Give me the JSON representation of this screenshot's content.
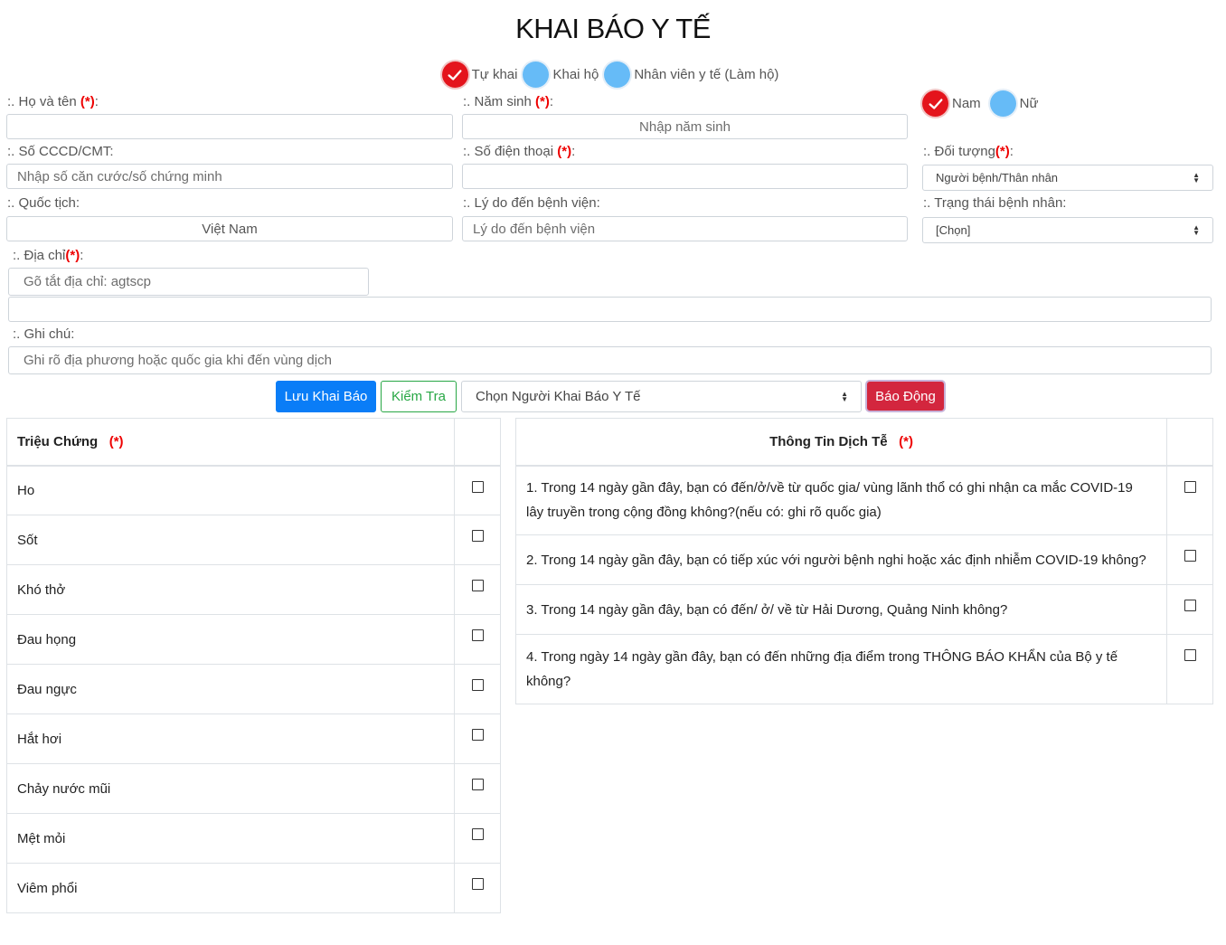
{
  "title": "KHAI BÁO Y TẾ",
  "declare_modes": [
    {
      "label": "Tự khai",
      "checked": true
    },
    {
      "label": "Khai hộ",
      "checked": false
    },
    {
      "label": "Nhân viên y tế (Làm hộ)",
      "checked": false
    }
  ],
  "form": {
    "req_marker": "(*)",
    "full_name": {
      "label": ":. Họ và tên ",
      "value": ""
    },
    "birth_year": {
      "label": ":. Năm sinh ",
      "placeholder": "Nhập năm sinh"
    },
    "gender": [
      {
        "label": "Nam",
        "checked": true
      },
      {
        "label": "Nữ",
        "checked": false
      }
    ],
    "id_number": {
      "label": ":. Số CCCD/CMT:",
      "placeholder": "Nhập số căn cước/số chứng minh"
    },
    "phone": {
      "label": ":. Số điện thoại ",
      "value": ""
    },
    "subject": {
      "label": ":. Đối tượng",
      "selected": "Người bệnh/Thân nhân"
    },
    "nationality": {
      "label": ":. Quốc tịch:",
      "value": "Việt Nam"
    },
    "visit_reason": {
      "label": ":. Lý do đến bệnh viện:",
      "placeholder": "Lý do đến bệnh viện"
    },
    "patient_status": {
      "label": ":. Trạng thái bệnh nhân:",
      "selected": "[Chọn]"
    },
    "address": {
      "label": ":. Địa chỉ",
      "placeholder": "Gõ tắt địa chỉ: agtscp",
      "full_value": ""
    },
    "note": {
      "label": ":. Ghi chú:",
      "placeholder": "Ghi rõ địa phương hoặc quốc gia khi đến vùng dịch"
    }
  },
  "actions": {
    "save_label": "Lưu Khai Báo",
    "check_label": "Kiểm Tra",
    "declarer_select": "Chọn Người Khai Báo Y Tế",
    "alarm_label": "Báo Động"
  },
  "symptoms": {
    "header": "Triệu Chứng",
    "items": [
      "Ho",
      "Sốt",
      "Khó thở",
      "Đau họng",
      "Đau ngực",
      "Hắt hơi",
      "Chảy nước mũi",
      "Mệt mỏi",
      "Viêm phổi"
    ]
  },
  "epidemiology": {
    "header": "Thông Tin Dịch Tễ",
    "items": [
      "1. Trong 14 ngày gần đây, bạn có đến/ở/về từ quốc gia/ vùng lãnh thổ có ghi nhận ca mắc COVID-19 lây truyền trong cộng đồng không?(nếu có: ghi rõ quốc gia)",
      "2. Trong 14 ngày gần đây, bạn có tiếp xúc với người bệnh nghi hoặc xác định nhiễm COVID-19 không?",
      "3. Trong 14 ngày gần đây, bạn có đến/ ở/ về từ Hải Dương, Quảng Ninh không?",
      "4. Trong ngày 14 ngày gần đây, bạn có đến những địa điểm trong THÔNG BÁO KHẨN của Bộ y tế không?"
    ]
  },
  "colors": {
    "primary": "#0a7df7",
    "danger": "#d3263e",
    "success": "#28a745",
    "radio_checked": "#e4141c",
    "radio_unchecked": "#66bbf7",
    "required": "#ee0000"
  }
}
